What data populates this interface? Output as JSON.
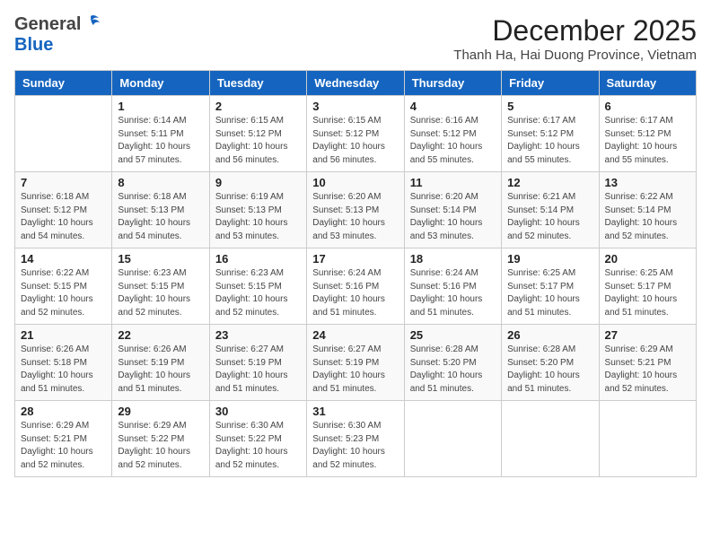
{
  "header": {
    "logo_general": "General",
    "logo_blue": "Blue",
    "month_title": "December 2025",
    "subtitle": "Thanh Ha, Hai Duong Province, Vietnam"
  },
  "days_of_week": [
    "Sunday",
    "Monday",
    "Tuesday",
    "Wednesday",
    "Thursday",
    "Friday",
    "Saturday"
  ],
  "weeks": [
    [
      {
        "day": "",
        "sunrise": "",
        "sunset": "",
        "daylight": ""
      },
      {
        "day": "1",
        "sunrise": "Sunrise: 6:14 AM",
        "sunset": "Sunset: 5:11 PM",
        "daylight": "Daylight: 10 hours and 57 minutes."
      },
      {
        "day": "2",
        "sunrise": "Sunrise: 6:15 AM",
        "sunset": "Sunset: 5:12 PM",
        "daylight": "Daylight: 10 hours and 56 minutes."
      },
      {
        "day": "3",
        "sunrise": "Sunrise: 6:15 AM",
        "sunset": "Sunset: 5:12 PM",
        "daylight": "Daylight: 10 hours and 56 minutes."
      },
      {
        "day": "4",
        "sunrise": "Sunrise: 6:16 AM",
        "sunset": "Sunset: 5:12 PM",
        "daylight": "Daylight: 10 hours and 55 minutes."
      },
      {
        "day": "5",
        "sunrise": "Sunrise: 6:17 AM",
        "sunset": "Sunset: 5:12 PM",
        "daylight": "Daylight: 10 hours and 55 minutes."
      },
      {
        "day": "6",
        "sunrise": "Sunrise: 6:17 AM",
        "sunset": "Sunset: 5:12 PM",
        "daylight": "Daylight: 10 hours and 55 minutes."
      }
    ],
    [
      {
        "day": "7",
        "sunrise": "Sunrise: 6:18 AM",
        "sunset": "Sunset: 5:12 PM",
        "daylight": "Daylight: 10 hours and 54 minutes."
      },
      {
        "day": "8",
        "sunrise": "Sunrise: 6:18 AM",
        "sunset": "Sunset: 5:13 PM",
        "daylight": "Daylight: 10 hours and 54 minutes."
      },
      {
        "day": "9",
        "sunrise": "Sunrise: 6:19 AM",
        "sunset": "Sunset: 5:13 PM",
        "daylight": "Daylight: 10 hours and 53 minutes."
      },
      {
        "day": "10",
        "sunrise": "Sunrise: 6:20 AM",
        "sunset": "Sunset: 5:13 PM",
        "daylight": "Daylight: 10 hours and 53 minutes."
      },
      {
        "day": "11",
        "sunrise": "Sunrise: 6:20 AM",
        "sunset": "Sunset: 5:14 PM",
        "daylight": "Daylight: 10 hours and 53 minutes."
      },
      {
        "day": "12",
        "sunrise": "Sunrise: 6:21 AM",
        "sunset": "Sunset: 5:14 PM",
        "daylight": "Daylight: 10 hours and 52 minutes."
      },
      {
        "day": "13",
        "sunrise": "Sunrise: 6:22 AM",
        "sunset": "Sunset: 5:14 PM",
        "daylight": "Daylight: 10 hours and 52 minutes."
      }
    ],
    [
      {
        "day": "14",
        "sunrise": "Sunrise: 6:22 AM",
        "sunset": "Sunset: 5:15 PM",
        "daylight": "Daylight: 10 hours and 52 minutes."
      },
      {
        "day": "15",
        "sunrise": "Sunrise: 6:23 AM",
        "sunset": "Sunset: 5:15 PM",
        "daylight": "Daylight: 10 hours and 52 minutes."
      },
      {
        "day": "16",
        "sunrise": "Sunrise: 6:23 AM",
        "sunset": "Sunset: 5:15 PM",
        "daylight": "Daylight: 10 hours and 52 minutes."
      },
      {
        "day": "17",
        "sunrise": "Sunrise: 6:24 AM",
        "sunset": "Sunset: 5:16 PM",
        "daylight": "Daylight: 10 hours and 51 minutes."
      },
      {
        "day": "18",
        "sunrise": "Sunrise: 6:24 AM",
        "sunset": "Sunset: 5:16 PM",
        "daylight": "Daylight: 10 hours and 51 minutes."
      },
      {
        "day": "19",
        "sunrise": "Sunrise: 6:25 AM",
        "sunset": "Sunset: 5:17 PM",
        "daylight": "Daylight: 10 hours and 51 minutes."
      },
      {
        "day": "20",
        "sunrise": "Sunrise: 6:25 AM",
        "sunset": "Sunset: 5:17 PM",
        "daylight": "Daylight: 10 hours and 51 minutes."
      }
    ],
    [
      {
        "day": "21",
        "sunrise": "Sunrise: 6:26 AM",
        "sunset": "Sunset: 5:18 PM",
        "daylight": "Daylight: 10 hours and 51 minutes."
      },
      {
        "day": "22",
        "sunrise": "Sunrise: 6:26 AM",
        "sunset": "Sunset: 5:19 PM",
        "daylight": "Daylight: 10 hours and 51 minutes."
      },
      {
        "day": "23",
        "sunrise": "Sunrise: 6:27 AM",
        "sunset": "Sunset: 5:19 PM",
        "daylight": "Daylight: 10 hours and 51 minutes."
      },
      {
        "day": "24",
        "sunrise": "Sunrise: 6:27 AM",
        "sunset": "Sunset: 5:19 PM",
        "daylight": "Daylight: 10 hours and 51 minutes."
      },
      {
        "day": "25",
        "sunrise": "Sunrise: 6:28 AM",
        "sunset": "Sunset: 5:20 PM",
        "daylight": "Daylight: 10 hours and 51 minutes."
      },
      {
        "day": "26",
        "sunrise": "Sunrise: 6:28 AM",
        "sunset": "Sunset: 5:20 PM",
        "daylight": "Daylight: 10 hours and 51 minutes."
      },
      {
        "day": "27",
        "sunrise": "Sunrise: 6:29 AM",
        "sunset": "Sunset: 5:21 PM",
        "daylight": "Daylight: 10 hours and 52 minutes."
      }
    ],
    [
      {
        "day": "28",
        "sunrise": "Sunrise: 6:29 AM",
        "sunset": "Sunset: 5:21 PM",
        "daylight": "Daylight: 10 hours and 52 minutes."
      },
      {
        "day": "29",
        "sunrise": "Sunrise: 6:29 AM",
        "sunset": "Sunset: 5:22 PM",
        "daylight": "Daylight: 10 hours and 52 minutes."
      },
      {
        "day": "30",
        "sunrise": "Sunrise: 6:30 AM",
        "sunset": "Sunset: 5:22 PM",
        "daylight": "Daylight: 10 hours and 52 minutes."
      },
      {
        "day": "31",
        "sunrise": "Sunrise: 6:30 AM",
        "sunset": "Sunset: 5:23 PM",
        "daylight": "Daylight: 10 hours and 52 minutes."
      },
      {
        "day": "",
        "sunrise": "",
        "sunset": "",
        "daylight": ""
      },
      {
        "day": "",
        "sunrise": "",
        "sunset": "",
        "daylight": ""
      },
      {
        "day": "",
        "sunrise": "",
        "sunset": "",
        "daylight": ""
      }
    ]
  ]
}
